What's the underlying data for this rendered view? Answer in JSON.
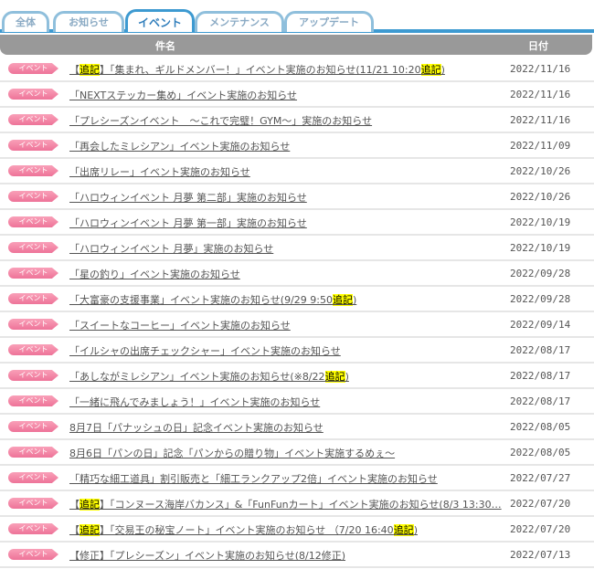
{
  "tabs": [
    "全体",
    "お知らせ",
    "イベント",
    "メンテナンス",
    "アップデート"
  ],
  "active_tab": 2,
  "header": {
    "title_col": "件名",
    "date_col": "日付"
  },
  "badge_label": "イベント",
  "rows": [
    {
      "title": [
        {
          "t": "【"
        },
        {
          "t": "追記",
          "hl": true
        },
        {
          "t": "】「集まれ、ギルドメンバー！」イベント実施のお知らせ(11/21 10:20"
        },
        {
          "t": "追記",
          "hl": true
        },
        {
          "t": ")"
        }
      ],
      "date": "2022/11/16"
    },
    {
      "title": [
        {
          "t": "「NEXTステッカー集め」イベント実施のお知らせ"
        }
      ],
      "date": "2022/11/16"
    },
    {
      "title": [
        {
          "t": "「プレシーズンイベント　～これで完璧！GYM～」実施のお知らせ"
        }
      ],
      "date": "2022/11/16"
    },
    {
      "title": [
        {
          "t": "「再会したミレシアン」イベント実施のお知らせ"
        }
      ],
      "date": "2022/11/09"
    },
    {
      "title": [
        {
          "t": "「出席リレー」イベント実施のお知らせ"
        }
      ],
      "date": "2022/10/26"
    },
    {
      "title": [
        {
          "t": "「ハロウィンイベント 月夢 第二部」実施のお知らせ"
        }
      ],
      "date": "2022/10/26"
    },
    {
      "title": [
        {
          "t": "「ハロウィンイベント 月夢 第一部」実施のお知らせ"
        }
      ],
      "date": "2022/10/19"
    },
    {
      "title": [
        {
          "t": "「ハロウィンイベント 月夢」実施のお知らせ"
        }
      ],
      "date": "2022/10/19"
    },
    {
      "title": [
        {
          "t": "「星の釣り」イベント実施のお知らせ"
        }
      ],
      "date": "2022/09/28"
    },
    {
      "title": [
        {
          "t": "「大富豪の支援事業」イベント実施のお知らせ(9/29 9:50"
        },
        {
          "t": "追記",
          "hl": true
        },
        {
          "t": ")"
        }
      ],
      "date": "2022/09/28"
    },
    {
      "title": [
        {
          "t": "「スイートなコーヒー」イベント実施のお知らせ"
        }
      ],
      "date": "2022/09/14"
    },
    {
      "title": [
        {
          "t": "「イルシャの出席チェックシャー」イベント実施のお知らせ"
        }
      ],
      "date": "2022/08/17"
    },
    {
      "title": [
        {
          "t": "「あしながミレシアン」イベント実施のお知らせ(※8/22"
        },
        {
          "t": "追記",
          "hl": true
        },
        {
          "t": ")"
        }
      ],
      "date": "2022/08/17"
    },
    {
      "title": [
        {
          "t": "「一緒に飛んでみましょう！」イベント実施のお知らせ"
        }
      ],
      "date": "2022/08/17"
    },
    {
      "title": [
        {
          "t": "8月7日「パナッシュの日」記念イベント実施のお知らせ"
        }
      ],
      "date": "2022/08/05"
    },
    {
      "title": [
        {
          "t": "8月6日「パンの日」記念「パンからの贈り物」イベント実施するめぇ～"
        }
      ],
      "date": "2022/08/05"
    },
    {
      "title": [
        {
          "t": "「精巧な細工道具」割引販売と「細工ランクアップ2倍」イベント実施のお知らせ"
        }
      ],
      "date": "2022/07/27"
    },
    {
      "title": [
        {
          "t": "【"
        },
        {
          "t": "追記",
          "hl": true
        },
        {
          "t": "】「コンヌース海岸バカンス」&「FunFunカート」イベント実施のお知らせ(8/3 13:30…"
        }
      ],
      "date": "2022/07/20"
    },
    {
      "title": [
        {
          "t": "【"
        },
        {
          "t": "追記",
          "hl": true
        },
        {
          "t": "】「交易王の秘宝ノート」イベント実施のお知らせ （7/20 16:40"
        },
        {
          "t": "追記",
          "hl": true
        },
        {
          "t": ")"
        }
      ],
      "date": "2022/07/20"
    },
    {
      "title": [
        {
          "t": "【修正】「プレシーズン」イベント実施のお知らせ(8/12修正)"
        }
      ],
      "date": "2022/07/13"
    }
  ]
}
